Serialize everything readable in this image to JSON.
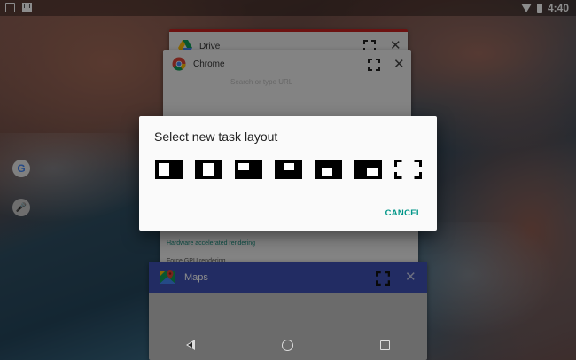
{
  "status_bar": {
    "time": "4:40",
    "notification_icons": [
      "image-icon",
      "gmail-icon"
    ],
    "system_icons": [
      "wifi-icon",
      "battery-icon"
    ]
  },
  "edge_icons": [
    "google-icon",
    "mic-icon"
  ],
  "edge": {
    "google_glyph": "G",
    "mic_glyph": "🎤"
  },
  "cards": {
    "drive": {
      "title": "Drive"
    },
    "chrome": {
      "title": "Chrome",
      "url_placeholder": "Search or type URL"
    },
    "settings": {
      "hw_label": "Hardware accelerated rendering",
      "gpu_label": "Force GPU rendering"
    },
    "maps": {
      "title": "Maps"
    }
  },
  "dialog": {
    "title": "Select new task layout",
    "cancel_label": "CANCEL",
    "layout_options": [
      "layout-left-half",
      "layout-left-third",
      "layout-top-left",
      "layout-top-center",
      "layout-bottom-center",
      "layout-bottom-right",
      "layout-fullscreen"
    ]
  },
  "colors": {
    "accent": "#009688",
    "maps_header": "#3f51b5",
    "drive_bar": "#c5221f"
  },
  "nav": {
    "back": "back-icon",
    "home": "home-icon",
    "recents": "recents-icon"
  }
}
